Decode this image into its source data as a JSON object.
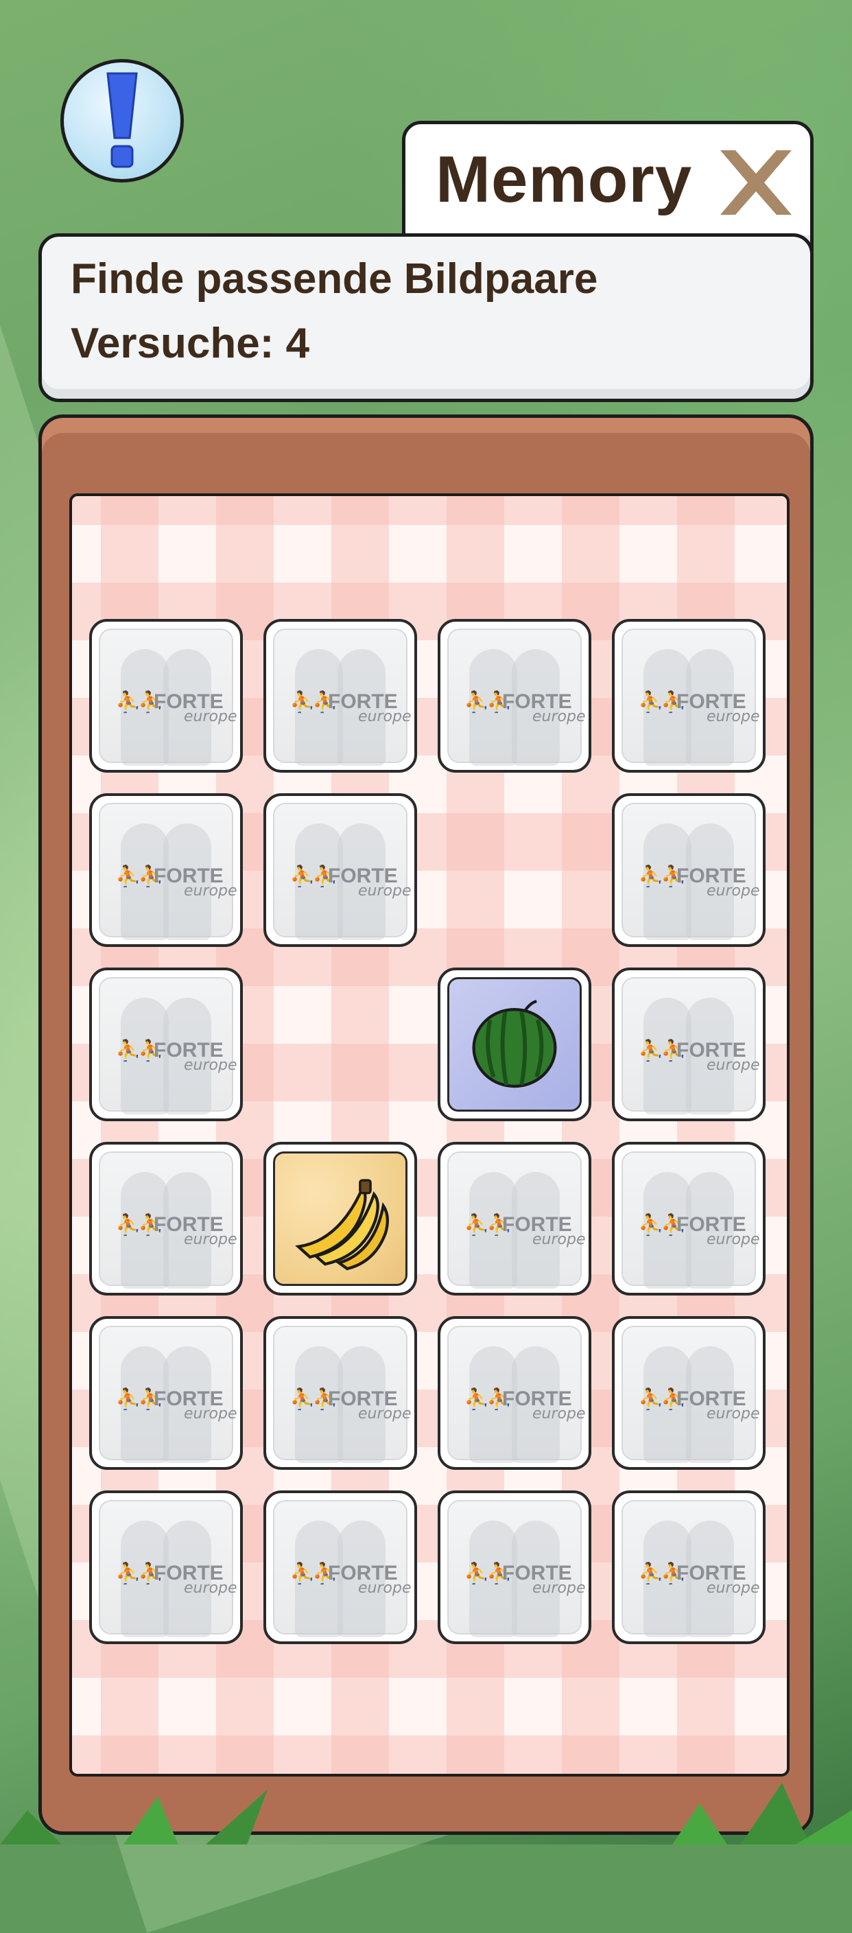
{
  "header": {
    "title": "Memory",
    "info_icon": "exclamation-icon",
    "close_icon": "close-x-icon"
  },
  "instructions": {
    "line1": "Finde passende Bildpaare",
    "line2": "Versuche: 4"
  },
  "card_back": {
    "brand": "FORTE",
    "brand_sub": "europe",
    "brand_icon": "people-icon"
  },
  "board": {
    "rows": 6,
    "cols": 4,
    "cells": [
      [
        "back",
        "back",
        "back",
        "back"
      ],
      [
        "back",
        "back",
        "empty",
        "back"
      ],
      [
        "back",
        "empty",
        "watermelon",
        "back"
      ],
      [
        "back",
        "banana",
        "back",
        "back"
      ],
      [
        "back",
        "back",
        "back",
        "back"
      ],
      [
        "back",
        "back",
        "back",
        "back"
      ]
    ]
  },
  "colors": {
    "board": "#b06f53",
    "text": "#3e2b1c",
    "close": "#a88867",
    "info": "#3b63e6"
  }
}
